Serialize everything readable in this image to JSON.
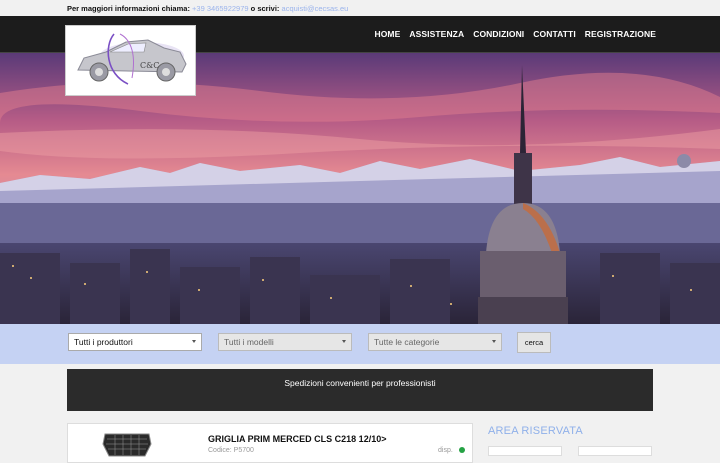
{
  "topbar": {
    "prefix": "Per maggiori informazioni chiama:",
    "phone": "+39 3465922979",
    "mid": "o scrivi:",
    "email": "acquisti@cecsas.eu"
  },
  "logo": {
    "text": "C&C"
  },
  "nav": {
    "items": [
      "HOME",
      "ASSISTENZA",
      "CONDIZIONI",
      "CONTATTI",
      "REGISTRAZIONE"
    ]
  },
  "filters": {
    "producers": "Tutti i produttori",
    "models": "Tutti i modelli",
    "categories": "Tutte le categorie",
    "search_label": "cerca"
  },
  "banner": {
    "text": "Spedizioni convenienti per professionisti"
  },
  "product": {
    "title": "GRIGLIA PRIM MERCED CLS C218 12/10>",
    "code": "Codice: P5700",
    "availability": "disp."
  },
  "sidebar": {
    "title": "AREA RISERVATA"
  },
  "colors": {
    "nav_bg": "#1c1c1c",
    "filter_bar": "#c5d2f3",
    "link": "#9bb4ec",
    "accent_title": "#8fb0ea",
    "available": "#25a244"
  }
}
